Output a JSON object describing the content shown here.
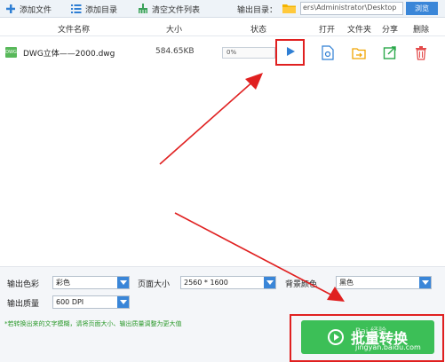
{
  "toolbar": {
    "add_file": "添加文件",
    "add_dir": "添加目录",
    "clear_list": "清空文件列表",
    "output_dir_label": "输出目录：",
    "output_path": "ers\\Administrator\\Desktop",
    "browse": "浏览"
  },
  "table": {
    "headers": {
      "name": "文件名称",
      "size": "大小",
      "status": "状态",
      "open": "打开",
      "folder": "文件夹",
      "share": "分享",
      "delete": "删除"
    },
    "rows": [
      {
        "icon_text": "DWG",
        "name": "DWG立体——2000.dwg",
        "size": "584.65KB",
        "progress": "0%"
      }
    ]
  },
  "settings": {
    "color_label": "输出色彩",
    "color_value": "彩色",
    "page_size_label": "页面大小",
    "page_size_value": "2560 * 1600",
    "bg_label": "背景颜色",
    "bg_value": "黑色",
    "quality_label": "输出质量",
    "quality_value": "600 DPI"
  },
  "tip": "*若转换出来的文字模糊，请将页面大小、输出质量调整为更大值",
  "convert_button": "批量转换",
  "watermark": {
    "line1": "Bai 经验",
    "line2": "jingyan.baidu.com"
  },
  "colors": {
    "accent_blue": "#3a86d8",
    "convert_green": "#3cbf57",
    "annotation_red": "#e02020",
    "tip_green": "#2c9a2c"
  }
}
